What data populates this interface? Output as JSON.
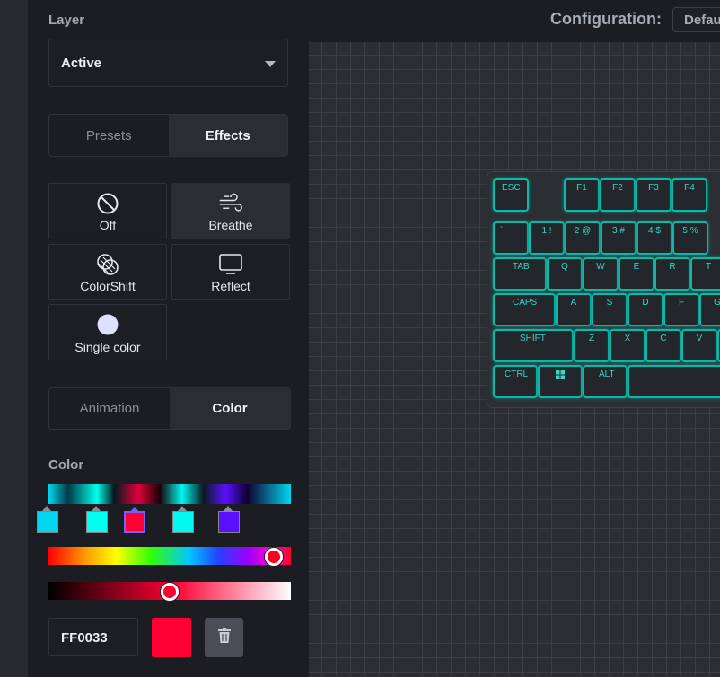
{
  "top": {
    "configuration_label": "Configuration:",
    "configuration_value": "Defau"
  },
  "layer": {
    "label": "Layer",
    "selected": "Active"
  },
  "mode_tabs": [
    {
      "label": "Presets",
      "active": false
    },
    {
      "label": "Effects",
      "active": true
    }
  ],
  "effects": [
    {
      "label": "Off",
      "icon": "prohibited-icon",
      "active": false
    },
    {
      "label": "Breathe",
      "icon": "wind-icon",
      "active": true
    },
    {
      "label": "ColorShift",
      "icon": "color-shift-icon",
      "active": false
    },
    {
      "label": "Reflect",
      "icon": "monitor-icon",
      "active": false
    },
    {
      "label": "Single color",
      "icon": "circle-icon",
      "active": false
    }
  ],
  "settings_tabs": [
    {
      "label": "Animation",
      "active": false
    },
    {
      "label": "Color",
      "active": true
    }
  ],
  "color": {
    "label": "Color",
    "stops": [
      "#00d8f0",
      "#00ffee",
      "#ff0033",
      "#00f8f0",
      "#5a10ff"
    ],
    "selected_stop": 2,
    "hue_position": 0.93,
    "lightness_position": 0.5,
    "hex_value": "FF0033",
    "swatch": "#ff0033",
    "delete_icon": "trash-icon"
  },
  "keyboard": {
    "rows": [
      [
        "ESC",
        "F1",
        "F2",
        "F3",
        "F4"
      ],
      [
        "` ~",
        "1 !",
        "2 @",
        "3 #",
        "4 $",
        "5 %"
      ],
      [
        "TAB",
        "Q",
        "W",
        "E",
        "R",
        "T"
      ],
      [
        "CAPS",
        "A",
        "S",
        "D",
        "F",
        "G"
      ],
      [
        "SHIFT",
        "Z",
        "X",
        "C",
        "V"
      ],
      [
        "CTRL",
        "",
        "ALT",
        ""
      ]
    ],
    "win_icon": "windows-icon"
  }
}
